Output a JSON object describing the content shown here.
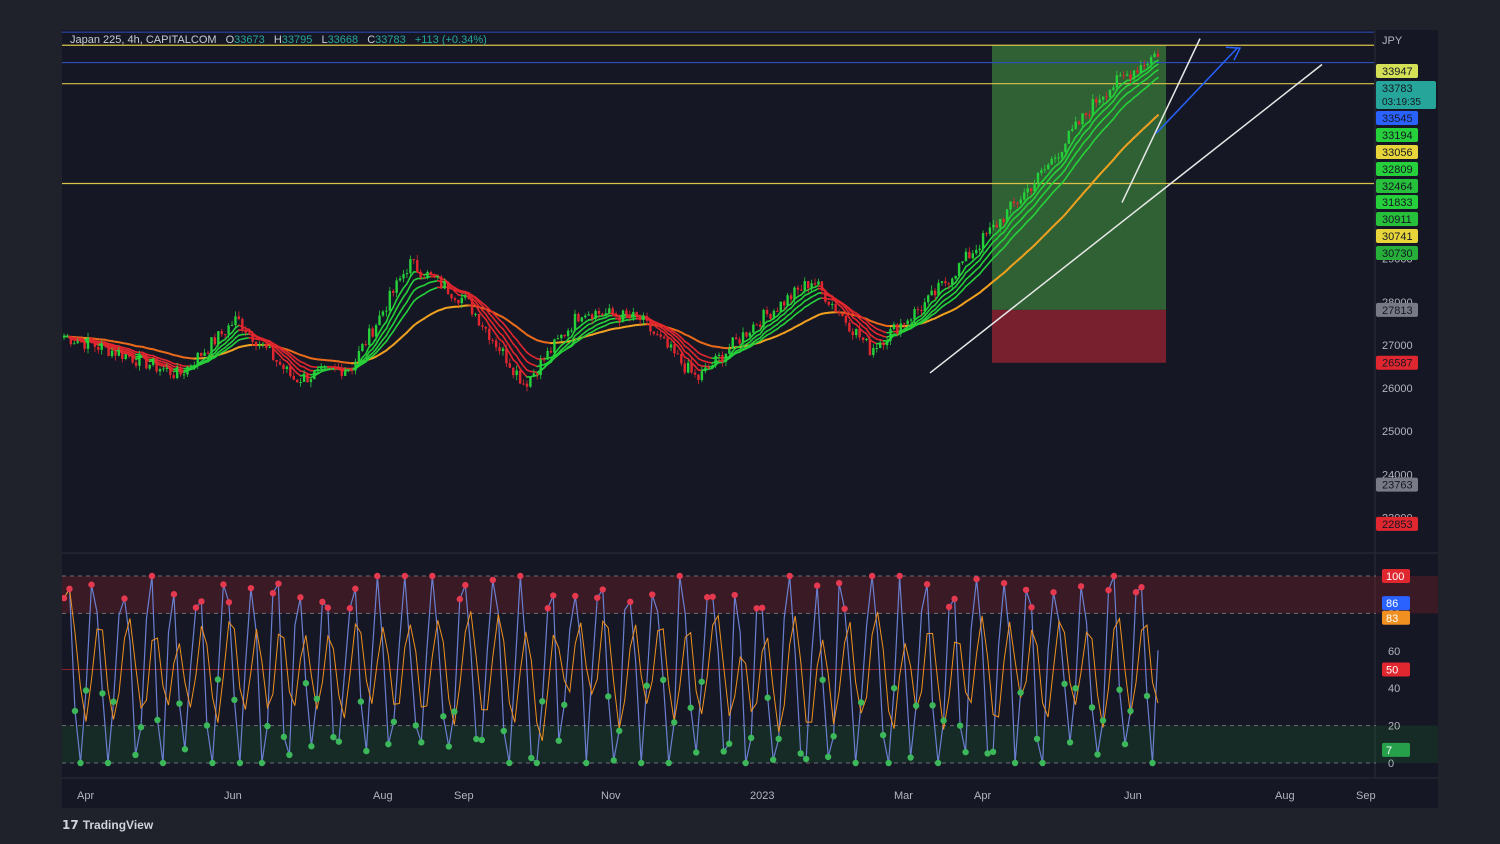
{
  "header": {
    "symbol": "Japan 225, 4h, CAPITALCOM",
    "open_label": "O",
    "open": "33673",
    "high_label": "H",
    "high": "33795",
    "low_label": "L",
    "low": "33668",
    "close_label": "C",
    "close": "33783",
    "change": "+113 (+0.34%)"
  },
  "branding": {
    "logo": "17",
    "name": "TradingView"
  },
  "colors": {
    "background": "#151824",
    "page": "#1f222b",
    "bull": "#26d03a",
    "bear": "#e0262e",
    "slow_ma": "#f0a020",
    "trend_line": "#e8e8e8",
    "arrow": "#2962ff",
    "level_yellow": "#d9c24a",
    "level_blue": "#2f4fbf",
    "profit_zone": "#3a7a3a",
    "loss_zone": "#8a2230",
    "stoch_line": "#6b7fd0",
    "stoch_signal": "#f09020"
  },
  "chart_data": [
    {
      "type": "candlestick",
      "currency": "JPY",
      "x_ticks": [
        "Apr",
        "Jun",
        "Aug",
        "Sep",
        "Nov",
        "2023",
        "Mar",
        "Apr",
        "Jun",
        "Aug",
        "Sep"
      ],
      "y_ticks": [
        23000,
        24000,
        25000,
        26000,
        27000,
        28000,
        29000
      ],
      "ylim": [
        22200,
        34300
      ],
      "approx_close_path": [
        {
          "x": "Apr",
          "y": 27200
        },
        {
          "x": "Apr",
          "y": 26800
        },
        {
          "x": "May",
          "y": 26300
        },
        {
          "x": "Jun",
          "y": 27600
        },
        {
          "x": "Jun",
          "y": 26200
        },
        {
          "x": "Jul",
          "y": 26500
        },
        {
          "x": "Aug",
          "y": 28900
        },
        {
          "x": "Sep",
          "y": 28000
        },
        {
          "x": "Oct",
          "y": 26100
        },
        {
          "x": "Nov",
          "y": 27800
        },
        {
          "x": "Dec",
          "y": 27600
        },
        {
          "x": "2023",
          "y": 26200
        },
        {
          "x": "Feb",
          "y": 27500
        },
        {
          "x": "Mar",
          "y": 28500
        },
        {
          "x": "Mar",
          "y": 26900
        },
        {
          "x": "Apr",
          "y": 28000
        },
        {
          "x": "May",
          "y": 29500
        },
        {
          "x": "May",
          "y": 31000
        },
        {
          "x": "Jun",
          "y": 32800
        },
        {
          "x": "Jun",
          "y": 33783
        }
      ],
      "price_labels": [
        {
          "value": "33947",
          "color": "#d4e157"
        },
        {
          "value": "33783",
          "sub": "03:19:35",
          "color": "#26a69a"
        },
        {
          "value": "33545",
          "color": "#2962ff"
        },
        {
          "value": "33194",
          "color": "#26d03a"
        },
        {
          "value": "33056",
          "color": "#e8d53a"
        },
        {
          "value": "32809",
          "color": "#26d03a"
        },
        {
          "value": "32464",
          "color": "#26c03a"
        },
        {
          "value": "31833",
          "color": "#26d03a"
        },
        {
          "value": "30911",
          "color": "#26c03a"
        },
        {
          "value": "30741",
          "color": "#e8d53a"
        },
        {
          "value": "30730",
          "color": "#26b03a"
        },
        {
          "value": "27813",
          "color": "#787b86"
        },
        {
          "value": "26587",
          "color": "#e0262e"
        },
        {
          "value": "23763",
          "color": "#787b86"
        },
        {
          "value": "22853",
          "color": "#e0262e"
        }
      ],
      "horizontal_levels": [
        33947,
        33545,
        33056,
        30741
      ],
      "position_tool": {
        "entry": 27813,
        "target": 33947,
        "stop": 26587,
        "from": "Apr",
        "to": "Jun"
      }
    },
    {
      "type": "line",
      "name": "Stochastic",
      "y_ticks": [
        0,
        20,
        40,
        60,
        80
      ],
      "ylim": [
        0,
        100
      ],
      "bands": {
        "overbought": 80,
        "oversold": 20
      },
      "price_labels": [
        {
          "value": "100",
          "color": "#e0262e"
        },
        {
          "value": "86",
          "color": "#2962ff"
        },
        {
          "value": "83",
          "color": "#f09020"
        },
        {
          "value": "50",
          "color": "#e0262e"
        },
        {
          "value": "7",
          "color": "#26a04a"
        }
      ]
    }
  ]
}
